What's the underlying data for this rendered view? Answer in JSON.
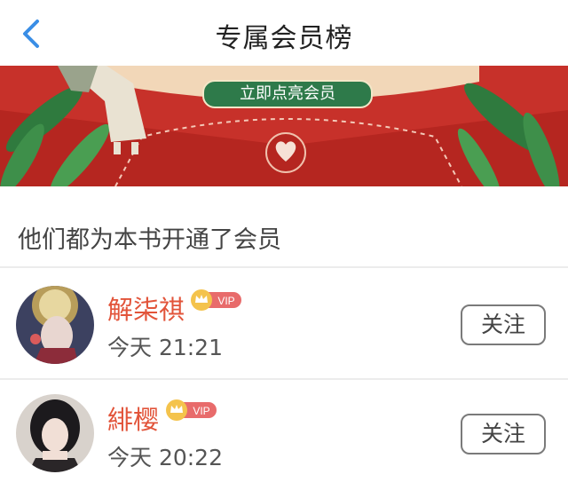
{
  "header": {
    "title": "专属会员榜"
  },
  "banner": {
    "cta_label": "立即点亮会员"
  },
  "section": {
    "label": "他们都为本书开通了会员"
  },
  "members": [
    {
      "name": "解柒祺",
      "badge": "VIP",
      "time": "今天 21:21",
      "follow_label": "关注",
      "avatar": "avatar-ornate-hairpiece"
    },
    {
      "name": "緋樱",
      "badge": "VIP",
      "time": "今天 20:22",
      "follow_label": "关注",
      "avatar": "avatar-dark-hair"
    }
  ],
  "colors": {
    "accent": "#e2543a",
    "banner_red": "#c7312a",
    "cta_green": "#2e7a4a",
    "back_blue": "#3a8ee6"
  }
}
